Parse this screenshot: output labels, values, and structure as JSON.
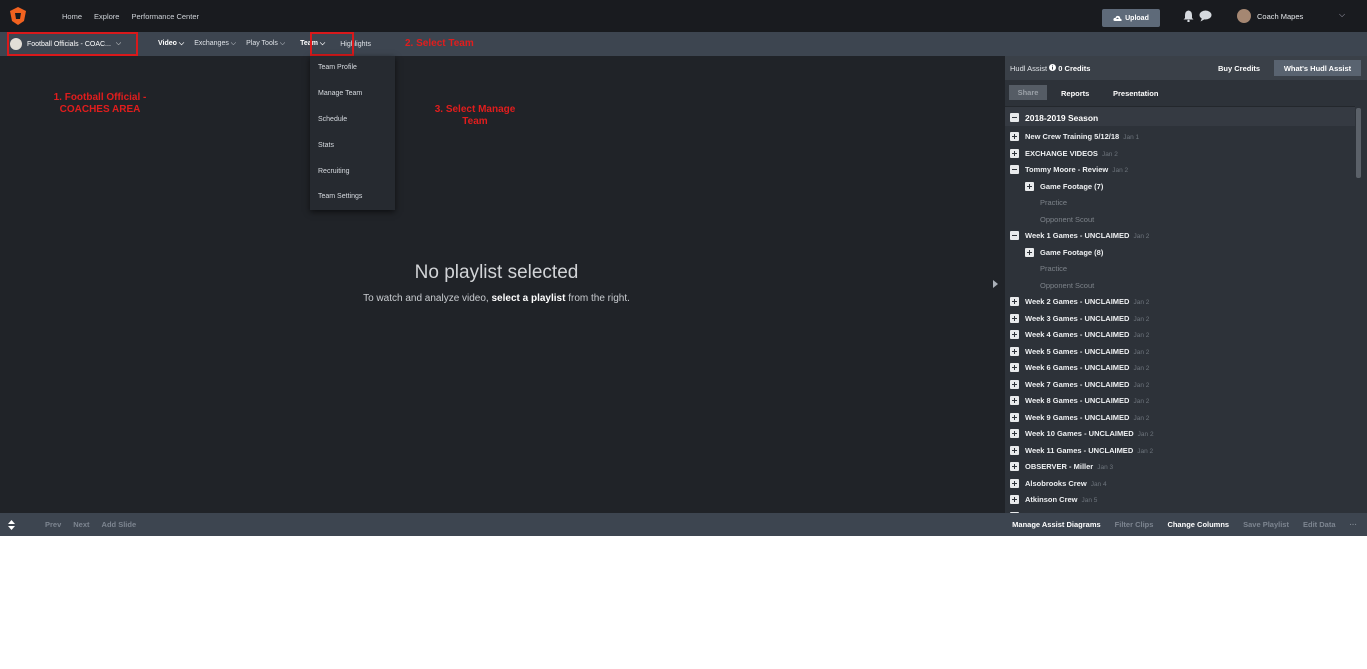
{
  "topbar": {
    "nav": [
      "Home",
      "Explore",
      "Performance Center"
    ],
    "upload_label": "Upload",
    "user_name": "Coach Mapes"
  },
  "subbar": {
    "org_label": "Football Officials - COAC...",
    "nav": [
      {
        "label": "Video",
        "chevron": "⌵"
      },
      {
        "label": "Exchanges",
        "chevron": "⌵"
      },
      {
        "label": "Play Tools",
        "chevron": "⌵"
      },
      {
        "label": "Team",
        "chevron": "⌵"
      },
      {
        "label": "Highlights",
        "chevron": ""
      }
    ]
  },
  "annotations": {
    "step1": "1. Football Official - COACHES AREA",
    "step2": "2. Select Team",
    "step3": "3. Select Manage Team"
  },
  "team_menu": [
    "Team Profile",
    "Manage Team",
    "Schedule",
    "Stats",
    "Recruiting",
    "Team Settings"
  ],
  "main": {
    "empty_title": "No playlist selected",
    "empty_sub_pre": "To watch and analyze video, ",
    "empty_sub_bold": "select a playlist",
    "empty_sub_post": " from the right."
  },
  "panel": {
    "assist_label": "Hudl Assist",
    "credits": "0 Credits",
    "buy_credits": "Buy Credits",
    "whats": "What's Hudl Assist",
    "tabs": {
      "share": "Share",
      "reports": "Reports",
      "presentation": "Presentation"
    },
    "season": "2018-2019 Season",
    "rows": [
      {
        "label": "New Crew Training 5/12/18",
        "date": "Jan 1",
        "icon": "plus",
        "level": 0
      },
      {
        "label": "EXCHANGE VIDEOS",
        "date": "Jan 2",
        "icon": "plus",
        "level": 0
      },
      {
        "label": "Tommy Moore - Review",
        "date": "Jan 2",
        "icon": "minus",
        "level": 0
      },
      {
        "label": "Game Footage (7)",
        "date": "",
        "icon": "plus",
        "level": 1
      },
      {
        "label": "Practice",
        "date": "",
        "icon": "",
        "level": 2
      },
      {
        "label": "Opponent Scout",
        "date": "",
        "icon": "",
        "level": 2
      },
      {
        "label": "Week 1 Games - UNCLAIMED",
        "date": "Jan 2",
        "icon": "minus",
        "level": 0
      },
      {
        "label": "Game Footage (8)",
        "date": "",
        "icon": "plus",
        "level": 1
      },
      {
        "label": "Practice",
        "date": "",
        "icon": "",
        "level": 2
      },
      {
        "label": "Opponent Scout",
        "date": "",
        "icon": "",
        "level": 2
      },
      {
        "label": "Week 2 Games - UNCLAIMED",
        "date": "Jan 2",
        "icon": "plus",
        "level": 0
      },
      {
        "label": "Week 3 Games - UNCLAIMED",
        "date": "Jan 2",
        "icon": "plus",
        "level": 0
      },
      {
        "label": "Week 4 Games - UNCLAIMED",
        "date": "Jan 2",
        "icon": "plus",
        "level": 0
      },
      {
        "label": "Week 5 Games - UNCLAIMED",
        "date": "Jan 2",
        "icon": "plus",
        "level": 0
      },
      {
        "label": "Week 6 Games - UNCLAIMED",
        "date": "Jan 2",
        "icon": "plus",
        "level": 0
      },
      {
        "label": "Week 7 Games - UNCLAIMED",
        "date": "Jan 2",
        "icon": "plus",
        "level": 0
      },
      {
        "label": "Week 8 Games - UNCLAIMED",
        "date": "Jan 2",
        "icon": "plus",
        "level": 0
      },
      {
        "label": "Week 9 Games - UNCLAIMED",
        "date": "Jan 2",
        "icon": "plus",
        "level": 0
      },
      {
        "label": "Week 10 Games - UNCLAIMED",
        "date": "Jan 2",
        "icon": "plus",
        "level": 0
      },
      {
        "label": "Week 11 Games - UNCLAIMED",
        "date": "Jan 2",
        "icon": "plus",
        "level": 0
      },
      {
        "label": "OBSERVER - Miller",
        "date": "Jan 3",
        "icon": "plus",
        "level": 0
      },
      {
        "label": "Alsobrooks Crew",
        "date": "Jan 4",
        "icon": "plus",
        "level": 0
      },
      {
        "label": "Atkinson Crew",
        "date": "Jan 5",
        "icon": "plus",
        "level": 0
      },
      {
        "label": "",
        "date": "",
        "icon": "minus",
        "level": 0
      }
    ]
  },
  "bottombar": {
    "left": [
      "Prev",
      "Next",
      "Add Slide"
    ],
    "right": [
      {
        "label": "Manage Assist Diagrams",
        "enabled": true
      },
      {
        "label": "Filter Clips",
        "enabled": false
      },
      {
        "label": "Change Columns",
        "enabled": true
      },
      {
        "label": "Save Playlist",
        "enabled": false
      },
      {
        "label": "Edit Data",
        "enabled": false
      },
      {
        "label": "···",
        "enabled": false
      }
    ]
  },
  "colors": {
    "brand": "#f2621f",
    "annotation": "#d9191b",
    "app_bg": "#202328"
  }
}
